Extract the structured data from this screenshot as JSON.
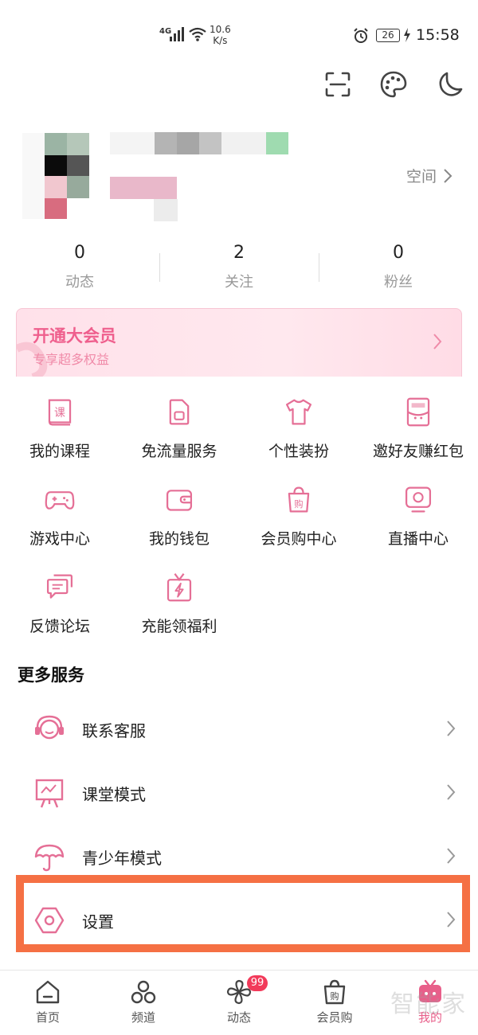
{
  "status_bar": {
    "network": "4G",
    "speed_value": "10.6",
    "speed_unit": "K/s",
    "battery": "26",
    "time": "15:58"
  },
  "profile": {
    "space_label": "空间"
  },
  "stats": [
    {
      "value": "0",
      "label": "动态"
    },
    {
      "value": "2",
      "label": "关注"
    },
    {
      "value": "0",
      "label": "粉丝"
    }
  ],
  "vip": {
    "title": "开通大会员",
    "subtitle": "专享超多权益"
  },
  "grid": [
    {
      "label": "我的课程",
      "icon": "course-book-icon"
    },
    {
      "label": "免流量服务",
      "icon": "sim-card-icon"
    },
    {
      "label": "个性装扮",
      "icon": "tshirt-icon"
    },
    {
      "label": "邀好友赚红包",
      "icon": "invite-envelope-icon"
    },
    {
      "label": "游戏中心",
      "icon": "gamepad-icon"
    },
    {
      "label": "我的钱包",
      "icon": "wallet-icon"
    },
    {
      "label": "会员购中心",
      "icon": "shopping-bag-icon"
    },
    {
      "label": "直播中心",
      "icon": "live-tv-icon"
    },
    {
      "label": "反馈论坛",
      "icon": "chat-bubble-icon"
    },
    {
      "label": "充能领福利",
      "icon": "gift-bolt-icon"
    }
  ],
  "more_services": {
    "title": "更多服务",
    "items": [
      {
        "label": "联系客服",
        "icon": "headset-icon"
      },
      {
        "label": "课堂模式",
        "icon": "classroom-board-icon"
      },
      {
        "label": "青少年模式",
        "icon": "umbrella-icon"
      },
      {
        "label": "设置",
        "icon": "settings-hexagon-icon"
      }
    ]
  },
  "bottom_nav": [
    {
      "label": "首页",
      "icon": "home-icon"
    },
    {
      "label": "频道",
      "icon": "channel-icon"
    },
    {
      "label": "动态",
      "icon": "pinwheel-icon",
      "badge": "99"
    },
    {
      "label": "会员购",
      "icon": "shop-bag-icon"
    },
    {
      "label": "我的",
      "icon": "tv-mine-icon",
      "active": true
    }
  ],
  "watermark": "智能家",
  "colors": {
    "accent": "#e85f8a",
    "highlight": "#f57044",
    "vip_text": "#ef5f8d"
  }
}
